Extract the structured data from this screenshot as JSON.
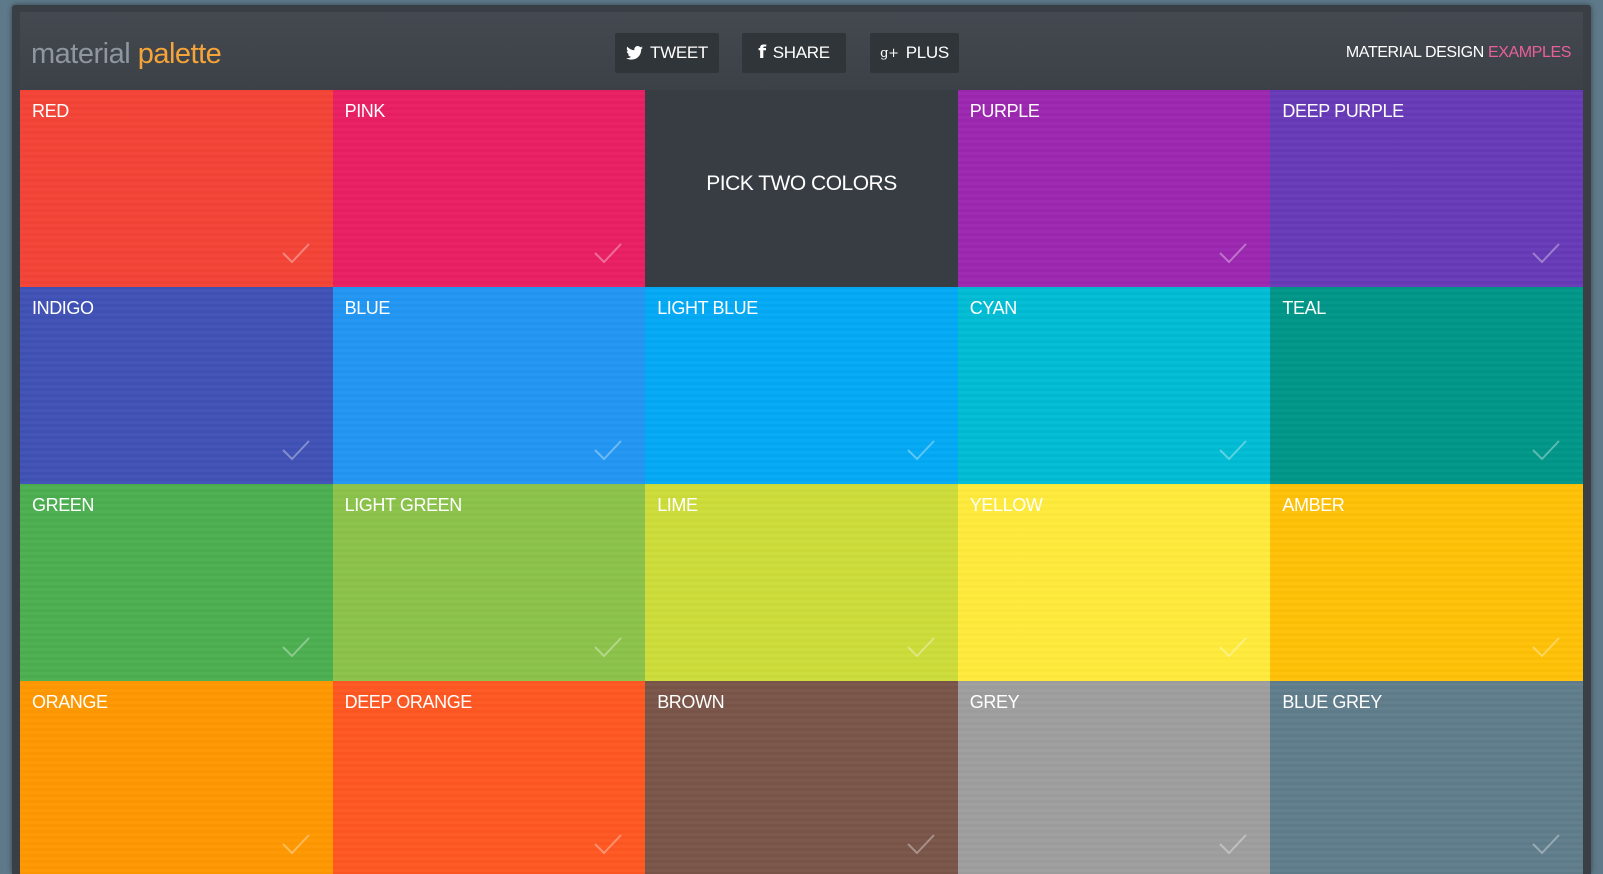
{
  "header": {
    "logo_light": "material",
    "logo_bold": "palette",
    "social": [
      {
        "label": "TWEET",
        "icon": "twitter-bird-icon"
      },
      {
        "label": "SHARE",
        "icon": "facebook-f-icon"
      },
      {
        "label": "PLUS",
        "icon": "google-plus-icon"
      }
    ],
    "link_main": "MATERIAL DESIGN",
    "link_accent": "EXAMPLES"
  },
  "picker_prompt": "PICK TWO COLORS",
  "colors": [
    {
      "name": "RED",
      "hex": "#f44336"
    },
    {
      "name": "PINK",
      "hex": "#e91e63"
    },
    {
      "name": "PURPLE",
      "hex": "#9c27b0"
    },
    {
      "name": "DEEP PURPLE",
      "hex": "#673ab7"
    },
    {
      "name": "INDIGO",
      "hex": "#3f51b5"
    },
    {
      "name": "BLUE",
      "hex": "#2196f3"
    },
    {
      "name": "LIGHT BLUE",
      "hex": "#03a9f4"
    },
    {
      "name": "CYAN",
      "hex": "#00bcd4"
    },
    {
      "name": "TEAL",
      "hex": "#009688"
    },
    {
      "name": "GREEN",
      "hex": "#4caf50"
    },
    {
      "name": "LIGHT GREEN",
      "hex": "#8bc34a"
    },
    {
      "name": "LIME",
      "hex": "#cddc39"
    },
    {
      "name": "YELLOW",
      "hex": "#ffeb3b"
    },
    {
      "name": "AMBER",
      "hex": "#ffc107"
    },
    {
      "name": "ORANGE",
      "hex": "#ff9800"
    },
    {
      "name": "DEEP ORANGE",
      "hex": "#ff5722"
    },
    {
      "name": "BROWN",
      "hex": "#795548"
    },
    {
      "name": "GREY",
      "hex": "#9e9e9e"
    },
    {
      "name": "BLUE GREY",
      "hex": "#607d8b"
    }
  ]
}
